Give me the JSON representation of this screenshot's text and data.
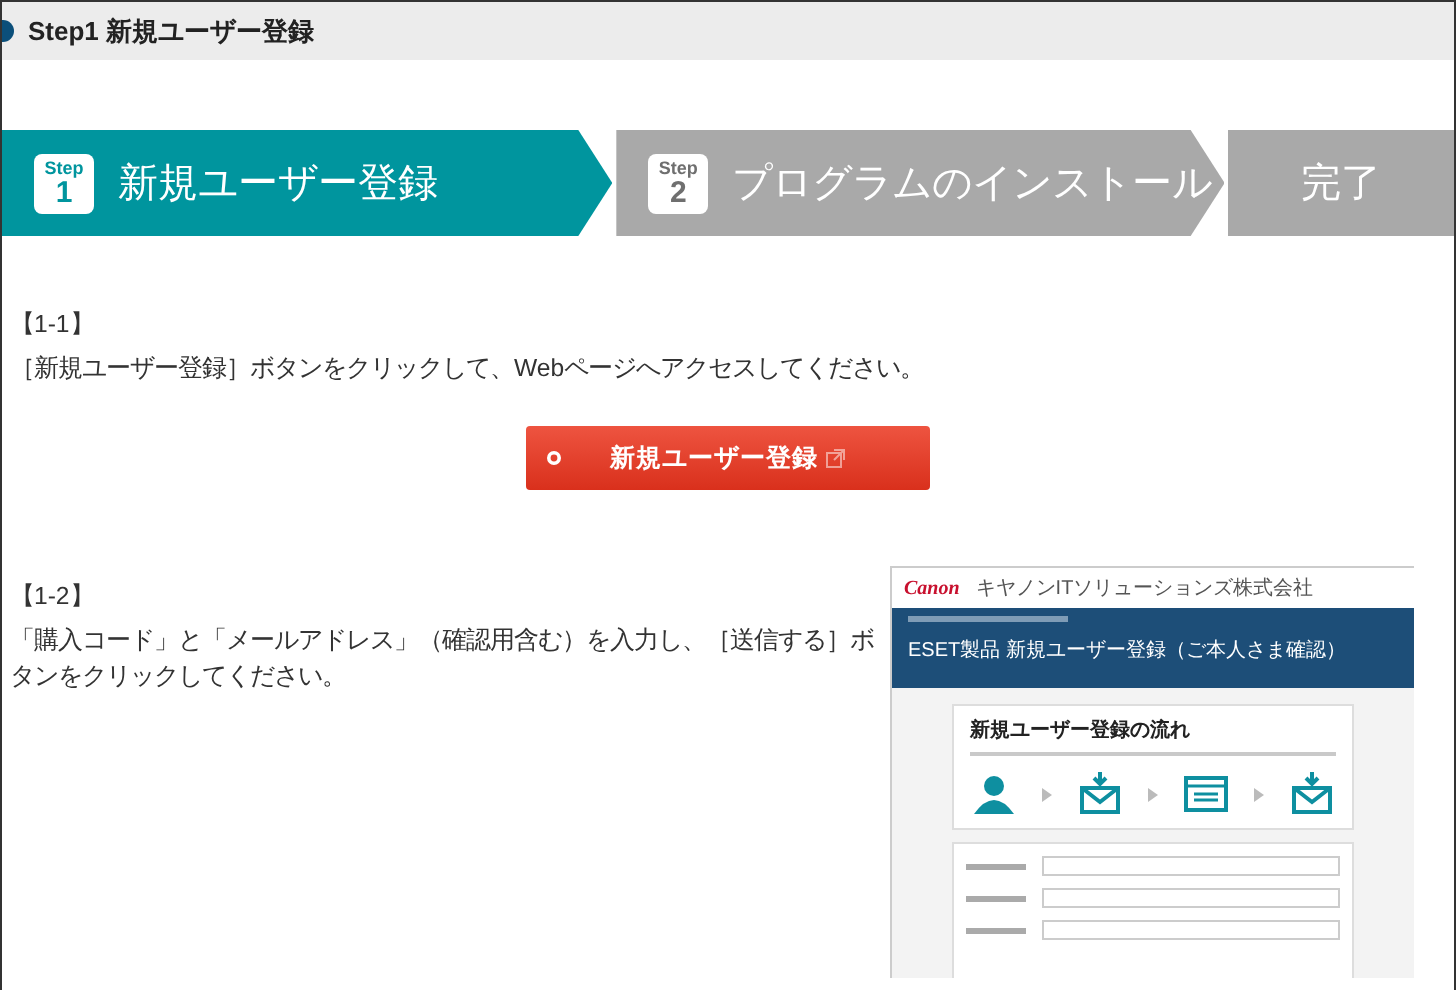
{
  "header": {
    "title": "Step1 新規ユーザー登録"
  },
  "steps": [
    {
      "badge_label": "Step",
      "badge_number": "1",
      "label": "新規ユーザー登録",
      "selected": true
    },
    {
      "badge_label": "Step",
      "badge_number": "2",
      "label": "プログラムのインストール",
      "selected": false
    },
    {
      "label": "完了",
      "selected": false
    }
  ],
  "sections": [
    {
      "heading": "【1-1】",
      "text": "［新規ユーザー登録］ボタンをクリックして、Webページへアクセスしてください。",
      "button": {
        "label": "新規ユーザー登録"
      }
    },
    {
      "heading": "【1-2】",
      "text": "「購入コード」と「メールアドレス」（確認用含む）を入力し、［送信する］ボタンをクリックしてください。",
      "screenshot": {
        "logo": "Canon",
        "company": "キヤノンITソリューションズ株式会社",
        "banner_title": "ESET製品 新規ユーザー登録（ご本人さま確認）",
        "card_title": "新規ユーザー登録の流れ"
      }
    }
  ]
}
